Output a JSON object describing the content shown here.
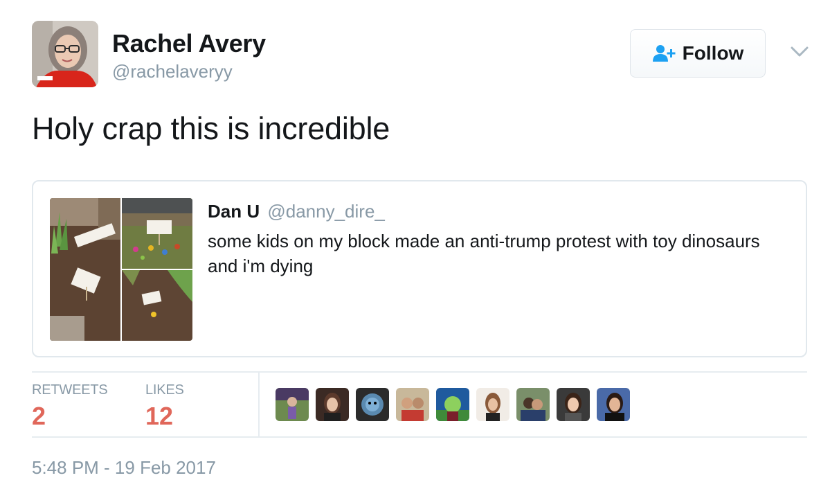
{
  "author": {
    "display_name": "Rachel Avery",
    "screen_name": "@rachelaveryy",
    "avatar_icon": "profile-photo"
  },
  "follow_button": {
    "label": "Follow",
    "icon": "follow-user-plus-icon",
    "icon_color": "#1da1f2"
  },
  "caret_icon": "chevron-down-icon",
  "tweet": {
    "text": "Holy crap this is incredible",
    "timestamp": "5:48 PM - 19 Feb 2017"
  },
  "quoted_tweet": {
    "name": "Dan U",
    "handle": "@danny_dire_",
    "text": "some kids on my block made an anti-trump protest with toy dinosaurs and i'm dying",
    "media": [
      "photo-garden-signs",
      "photo-dinosaurs-lawn",
      "photo-dinosaurs-mulch"
    ]
  },
  "stats": {
    "retweets_label": "RETWEETS",
    "retweets_count": "2",
    "likes_label": "LIKES",
    "likes_count": "12",
    "count_color": "#e0675a"
  },
  "likers": [
    "liker-avatar-1",
    "liker-avatar-2",
    "liker-avatar-3",
    "liker-avatar-4",
    "liker-avatar-5",
    "liker-avatar-6",
    "liker-avatar-7",
    "liker-avatar-8",
    "liker-avatar-9"
  ]
}
